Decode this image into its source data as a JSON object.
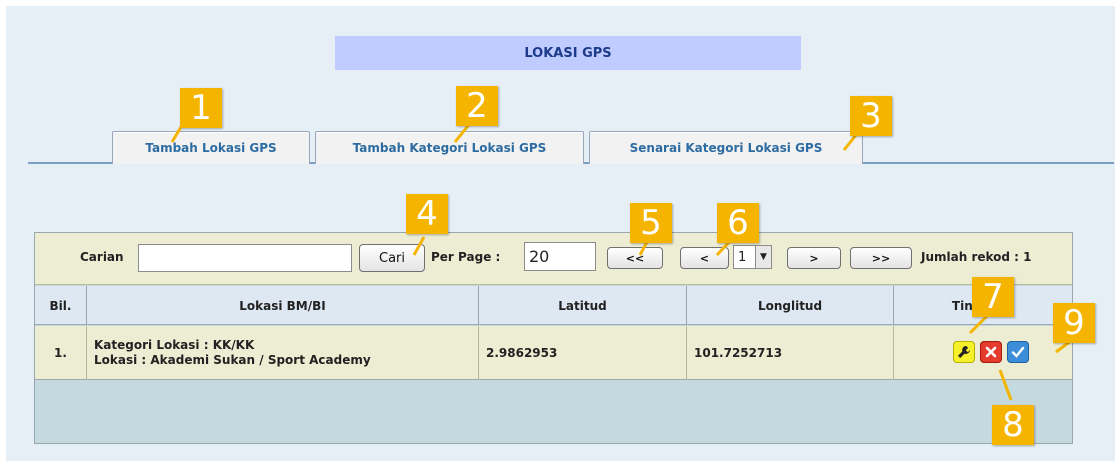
{
  "page": {
    "title": "LOKASI GPS"
  },
  "tabs": [
    {
      "label": "Tambah Lokasi GPS"
    },
    {
      "label": "Tambah Kategori Lokasi GPS"
    },
    {
      "label": "Senarai Kategori Lokasi GPS"
    }
  ],
  "toolbar": {
    "search_label": "Carian",
    "search_value": "",
    "search_button": "Cari",
    "per_page_label": "Per Page :",
    "per_page_value": "20",
    "first_button": "<<",
    "prev_button": "<",
    "page_number": "1",
    "next_button": ">",
    "last_button": ">>",
    "record_count": "Jumlah rekod : 1"
  },
  "table": {
    "columns": [
      "Bil.",
      "Lokasi BM/BI",
      "Latitud",
      "Longlitud",
      "Tindakan"
    ],
    "rows": [
      {
        "no": "1.",
        "category": "Kategori Lokasi : KK/KK",
        "location": "Lokasi : Akademi Sukan / Sport Academy",
        "latitude": "2.9862953",
        "longitude": "101.7252713"
      }
    ]
  },
  "callouts": [
    "1",
    "2",
    "3",
    "4",
    "5",
    "6",
    "7",
    "8",
    "9"
  ],
  "colors": {
    "marker": "#f5b400",
    "tab_text": "#2d6ca2",
    "title_bar": "#c0cbff",
    "row_bg": "#ededd4"
  },
  "icons": {
    "edit": "wrench-icon",
    "delete": "delete-x-icon",
    "approve": "checkmark-icon",
    "dropdown": "chevron-down-icon"
  }
}
